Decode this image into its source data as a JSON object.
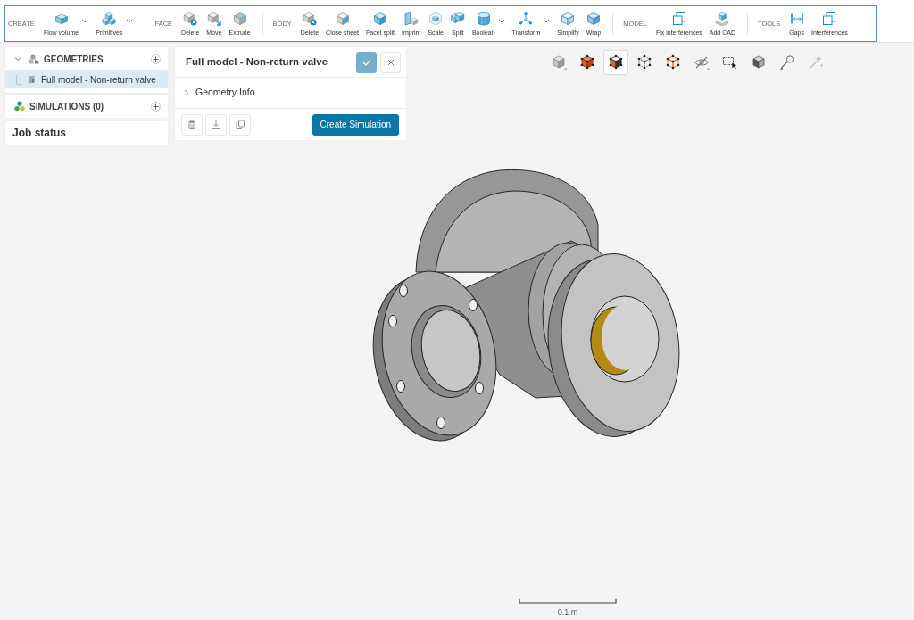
{
  "toolbar": {
    "groups": [
      {
        "label": "CREATE",
        "tools": [
          {
            "label": "Flow volume",
            "dropdown": true
          },
          {
            "label": "Primitives",
            "dropdown": true
          }
        ]
      },
      {
        "label": "FACE",
        "tools": [
          {
            "label": "Delete",
            "dropdown": false
          },
          {
            "label": "Move",
            "dropdown": false
          },
          {
            "label": "Extrude",
            "dropdown": false
          }
        ]
      },
      {
        "label": "BODY",
        "tools": [
          {
            "label": "Delete",
            "dropdown": false
          },
          {
            "label": "Close sheet",
            "dropdown": false
          },
          {
            "label": "Facet split",
            "dropdown": false
          },
          {
            "label": "Imprint",
            "dropdown": false
          },
          {
            "label": "Scale",
            "dropdown": false
          },
          {
            "label": "Split",
            "dropdown": false
          },
          {
            "label": "Boolean",
            "dropdown": true
          },
          {
            "label": "Transform",
            "dropdown": true
          },
          {
            "label": "Simplify",
            "dropdown": false
          },
          {
            "label": "Wrap",
            "dropdown": false
          }
        ]
      },
      {
        "label": "MODEL",
        "tools": [
          {
            "label": "Fix interferences",
            "dropdown": false
          },
          {
            "label": "Add CAD",
            "dropdown": false
          }
        ]
      },
      {
        "label": "TOOLS",
        "tools": [
          {
            "label": "Gaps",
            "dropdown": false
          },
          {
            "label": "Interferences",
            "dropdown": false
          }
        ]
      }
    ]
  },
  "tree": {
    "sections": [
      {
        "title": "GEOMETRIES",
        "expanded": true,
        "children": [
          {
            "label": "Full model - Non-return valve",
            "selected": true
          }
        ]
      },
      {
        "title": "SIMULATIONS (0)"
      }
    ]
  },
  "job_status": {
    "title": "Job status"
  },
  "detail_panel": {
    "title": "Full model - Non-return valve",
    "confirm_disabled": true,
    "sections": [
      {
        "label": "Geometry Info",
        "expanded": false
      }
    ],
    "primary_button": "Create Simulation"
  },
  "view_toolbar": [
    {
      "kind": "shaded",
      "selected": false,
      "disabled": false,
      "dropdown": true
    },
    {
      "kind": "faces",
      "selected": false,
      "disabled": false,
      "dropdown": false
    },
    {
      "kind": "faces-vertices",
      "selected": true,
      "disabled": false,
      "dropdown": false
    },
    {
      "kind": "vertices",
      "selected": false,
      "disabled": false,
      "dropdown": false
    },
    {
      "kind": "edges",
      "selected": false,
      "disabled": false,
      "dropdown": false
    },
    {
      "kind": "hide",
      "selected": false,
      "disabled": false,
      "dropdown": true
    },
    {
      "kind": "box-select",
      "selected": false,
      "disabled": false,
      "dropdown": false
    },
    {
      "kind": "section",
      "selected": false,
      "disabled": false,
      "dropdown": false
    },
    {
      "kind": "measure",
      "selected": false,
      "disabled": false,
      "dropdown": false
    },
    {
      "kind": "ai",
      "selected": false,
      "disabled": true,
      "dropdown": false
    }
  ],
  "scale_bar": {
    "label": "0.1 m"
  }
}
